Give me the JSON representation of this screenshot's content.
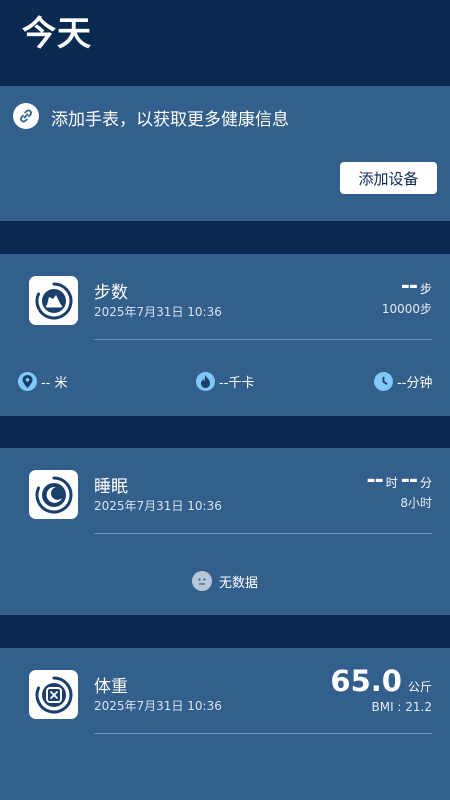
{
  "header": {
    "title": "今天"
  },
  "watch_card": {
    "message": "添加手表，以获取更多健康信息",
    "button_label": "添加设备"
  },
  "steps": {
    "title": "步数",
    "timestamp": "2025年7月31日 10:36",
    "value": "--",
    "unit": "步",
    "goal": "10000步",
    "stats": {
      "distance": "-- 米",
      "calories": "--千卡",
      "duration": "--分钟"
    }
  },
  "sleep": {
    "title": "睡眠",
    "timestamp": "2025年7月31日 10:36",
    "hours_value": "--",
    "hours_unit": "时",
    "minutes_value": "--",
    "minutes_unit": "分",
    "goal": "8小时",
    "empty_text": "无数据"
  },
  "weight": {
    "title": "体重",
    "timestamp": "2025年7月31日 10:36",
    "value": "65.0",
    "unit": "公斤",
    "bmi": "BMI : 21.2"
  },
  "colors": {
    "background": "#0b2a52",
    "card": "#325f8b",
    "accent_icon": "#7fc8f8"
  }
}
